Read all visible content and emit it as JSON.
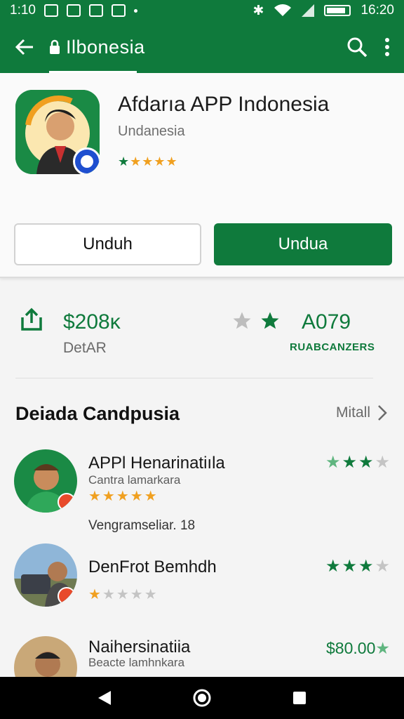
{
  "status_bar": {
    "time": "1:10",
    "clock": "16:20"
  },
  "app_bar": {
    "title": "Ilbonesia"
  },
  "app": {
    "name": "Afdarıa APP Indonesia",
    "publisher": "Undanesia",
    "rating_stars": "★★★★★",
    "buttons": {
      "secondary": "Unduh",
      "primary": "Undua"
    }
  },
  "stats": {
    "value": "$208ĸ",
    "label": "DetAR",
    "value2": "A079",
    "label2": "RUABCANZERS"
  },
  "section": {
    "title": "Deiada Candpusia",
    "more": "Mitall"
  },
  "list": [
    {
      "name": "APPl Henarinatiıla",
      "sub": "Cantra lamarkara",
      "stars": "★★★★★",
      "meta": "Vengramseliar. 18",
      "right_stars": "★★★★"
    },
    {
      "name": "DenFrot Bemhdh",
      "stars": "★★★★★",
      "right_stars": "★★★★"
    },
    {
      "name": "Naihersinatiia",
      "sub": "Beacte lamhnkara",
      "price": "$80.00"
    }
  ],
  "colors": {
    "brand": "#0f7a3c",
    "star": "#f0a020"
  }
}
